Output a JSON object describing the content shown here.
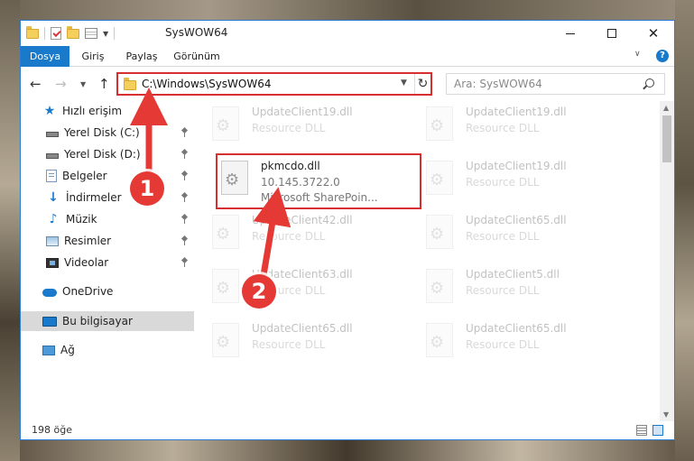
{
  "window": {
    "title": "SysWOW64"
  },
  "ribbon": {
    "tabs": [
      {
        "label": "Dosya"
      },
      {
        "label": "Giriş"
      },
      {
        "label": "Paylaş"
      },
      {
        "label": "Görünüm"
      }
    ],
    "help_label": "?"
  },
  "address": {
    "path": "C:\\Windows\\SysWOW64",
    "search_placeholder": "Ara: SysWOW64"
  },
  "sidebar": {
    "items": [
      {
        "label": "Hızlı erişim",
        "icon": "star-icon"
      },
      {
        "label": "Yerel Disk (C:)",
        "icon": "disk-icon",
        "pinned": true
      },
      {
        "label": "Yerel Disk (D:)",
        "icon": "disk-icon",
        "pinned": true
      },
      {
        "label": "Belgeler",
        "icon": "documents-icon",
        "pinned": true
      },
      {
        "label": "İndirmeler",
        "icon": "downloads-icon",
        "pinned": true
      },
      {
        "label": "Müzik",
        "icon": "music-icon",
        "pinned": true
      },
      {
        "label": "Resimler",
        "icon": "pictures-icon",
        "pinned": true
      },
      {
        "label": "Videolar",
        "icon": "videos-icon",
        "pinned": true
      },
      {
        "label": "OneDrive",
        "icon": "cloud-icon"
      },
      {
        "label": "Bu bilgisayar",
        "icon": "computer-icon",
        "selected": true
      },
      {
        "label": "Ağ",
        "icon": "network-icon"
      }
    ]
  },
  "files": [
    {
      "name": "UpdateClient19.dll",
      "line1": "Resource DLL",
      "line2": "",
      "faded": true
    },
    {
      "name": "UpdateClient19.dll",
      "line1": "Resource DLL",
      "line2": "",
      "faded": true
    },
    {
      "name": "pkmcdo.dll",
      "line1": "10.145.3722.0",
      "line2": "Microsoft SharePoin...",
      "faded": false,
      "highlighted": true
    },
    {
      "name": "UpdateClient19.dll",
      "line1": "Resource DLL",
      "line2": "",
      "faded": true
    },
    {
      "name": "UpdateClient42.dll",
      "line1": "Resource DLL",
      "line2": "",
      "faded": true
    },
    {
      "name": "UpdateClient65.dll",
      "line1": "Resource DLL",
      "line2": "",
      "faded": true
    },
    {
      "name": "UpdateClient63.dll",
      "line1": "Resource DLL",
      "line2": "",
      "faded": true
    },
    {
      "name": "UpdateClient5.dll",
      "line1": "Resource DLL",
      "line2": "",
      "faded": true
    },
    {
      "name": "UpdateClient65.dll",
      "line1": "Resource DLL",
      "line2": "",
      "faded": true
    },
    {
      "name": "UpdateClient65.dll",
      "line1": "Resource DLL",
      "line2": "",
      "faded": true
    }
  ],
  "status": {
    "item_count": "198 öğe"
  },
  "annotations": {
    "step1": "1",
    "step2": "2",
    "color": "#e53935"
  },
  "colors": {
    "accent": "#1979ca",
    "highlight_border": "#d72f2f"
  }
}
